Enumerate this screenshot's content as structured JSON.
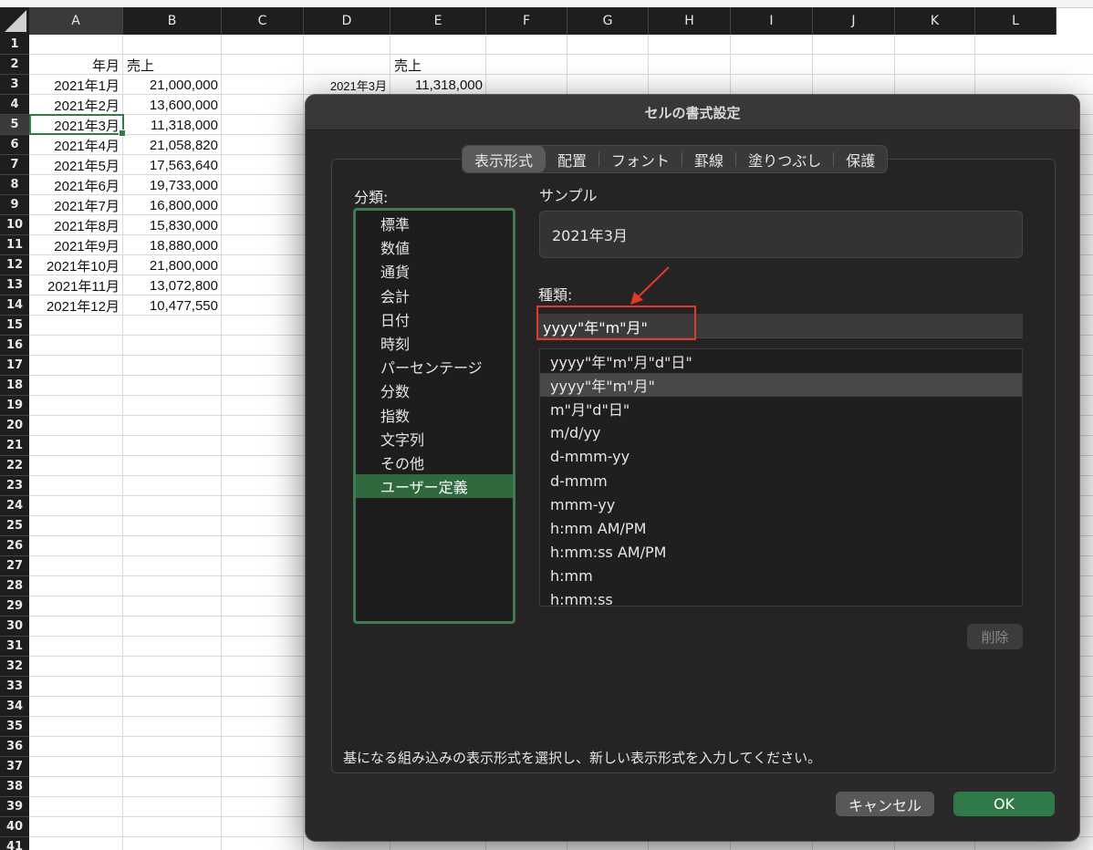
{
  "sheet": {
    "columns": [
      "A",
      "B",
      "C",
      "D",
      "E",
      "F",
      "G",
      "H",
      "I",
      "J",
      "K",
      "L"
    ],
    "rows": [
      "1",
      "2",
      "3",
      "4",
      "5",
      "6",
      "7",
      "8",
      "9",
      "10",
      "11",
      "12",
      "13",
      "14",
      "15",
      "16",
      "17",
      "18",
      "19",
      "20",
      "21",
      "22",
      "23",
      "24",
      "25",
      "26",
      "27",
      "28",
      "29",
      "30",
      "31",
      "32",
      "33",
      "34",
      "35",
      "36",
      "37",
      "38",
      "39",
      "40",
      "41"
    ],
    "header_a": "年月",
    "header_b": "売上",
    "data": [
      {
        "month": "2021年1月",
        "sales": "21,000,000"
      },
      {
        "month": "2021年2月",
        "sales": "13,600,000"
      },
      {
        "month": "2021年3月",
        "sales": "11,318,000"
      },
      {
        "month": "2021年4月",
        "sales": "21,058,820"
      },
      {
        "month": "2021年5月",
        "sales": "17,563,640"
      },
      {
        "month": "2021年6月",
        "sales": "19,733,000"
      },
      {
        "month": "2021年7月",
        "sales": "16,800,000"
      },
      {
        "month": "2021年8月",
        "sales": "15,830,000"
      },
      {
        "month": "2021年9月",
        "sales": "18,880,000"
      },
      {
        "month": "2021年10月",
        "sales": "21,800,000"
      },
      {
        "month": "2021年11月",
        "sales": "13,072,800"
      },
      {
        "month": "2021年12月",
        "sales": "10,477,550"
      }
    ],
    "e2": "売上",
    "d3": "2021年3月",
    "e3": "11,318,000",
    "selected_cell": "A5"
  },
  "dialog": {
    "title": "セルの書式設定",
    "tabs": [
      "表示形式",
      "配置",
      "フォント",
      "罫線",
      "塗りつぶし",
      "保護"
    ],
    "active_tab": "表示形式",
    "category_label": "分類:",
    "categories": [
      "標準",
      "数値",
      "通貨",
      "会計",
      "日付",
      "時刻",
      "パーセンテージ",
      "分数",
      "指数",
      "文字列",
      "その他",
      "ユーザー定義"
    ],
    "selected_category": "ユーザー定義",
    "sample_label": "サンプル",
    "sample_value": "2021年3月",
    "type_label": "種類:",
    "type_value": "yyyy\"年\"m\"月\"",
    "formats": [
      "yyyy\"年\"m\"月\"d\"日\"",
      "yyyy\"年\"m\"月\"",
      "m\"月\"d\"日\"",
      "m/d/yy",
      "d-mmm-yy",
      "d-mmm",
      "mmm-yy",
      "h:mm AM/PM",
      "h:mm:ss AM/PM",
      "h:mm",
      "h:mm:ss"
    ],
    "selected_format": "yyyy\"年\"m\"月\"",
    "delete_label": "削除",
    "hint": "基になる組み込みの表示形式を選択し、新しい表示形式を入力してください。",
    "cancel_label": "キャンセル",
    "ok_label": "OK"
  },
  "colors": {
    "accent_green": "#2e7d46",
    "annotation_red": "#e13a28"
  }
}
